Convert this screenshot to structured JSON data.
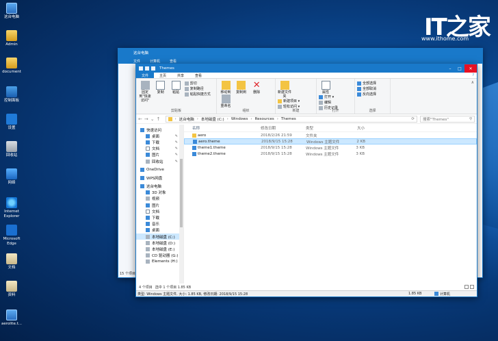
{
  "desktop": {
    "icons": [
      {
        "label": "这台电脑",
        "icon": "computer-icon"
      },
      {
        "label": "Admin",
        "icon": "user-folder-icon"
      },
      {
        "label": "document",
        "icon": "document-folder-icon"
      },
      {
        "label": "控制面板",
        "icon": "control-panel-icon"
      },
      {
        "label": "设置",
        "icon": "settings-icon"
      },
      {
        "label": "回收站",
        "icon": "recycle-bin-icon"
      },
      {
        "label": "网络",
        "icon": "network-icon"
      },
      {
        "label": "Internet Explorer",
        "icon": "ie-icon"
      },
      {
        "label": "Microsoft Edge",
        "icon": "edge-icon"
      },
      {
        "label": "文档",
        "icon": "file-icon"
      },
      {
        "label": "资料",
        "icon": "file-icon"
      },
      {
        "label": "aerolite.t...",
        "icon": "theme-file-icon"
      }
    ],
    "watermark": {
      "logo": "IT之家",
      "url": "www.ithome.com"
    }
  },
  "back_window": {
    "title": "这台电脑",
    "tabs": [
      "文件",
      "计算机",
      "查看"
    ],
    "status": "15 个项目"
  },
  "explorer": {
    "title": "Themes",
    "tabs": {
      "file": "文件",
      "home": "主页",
      "share": "共享",
      "view": "查看"
    },
    "ribbon": {
      "clipboard": {
        "pin": "固定到\"快速访问\"",
        "copy": "复制",
        "paste": "粘贴",
        "cut": "剪切",
        "copy_path": "复制路径",
        "paste_shortcut": "粘贴快捷方式",
        "label": "剪贴板"
      },
      "organize": {
        "move_to": "移动到",
        "copy_to": "复制到",
        "delete": "删除",
        "rename": "重命名",
        "label": "组织"
      },
      "new": {
        "new_folder": "新建文件夹",
        "new_item": "新建项目 ▾",
        "easy_access": "轻松访问 ▾",
        "label": "新建"
      },
      "open": {
        "properties": "属性",
        "open": "打开 ▾",
        "edit": "编辑",
        "history": "历史记录",
        "label": "打开"
      },
      "select": {
        "select_all": "全部选择",
        "select_none": "全部取消",
        "invert": "反向选择",
        "label": "选择"
      }
    },
    "address": {
      "crumbs": [
        "这台电脑",
        "本地磁盘 (C:)",
        "Windows",
        "Resources",
        "Themes"
      ],
      "search_placeholder": "搜索\"Themes\""
    },
    "nav": [
      {
        "label": "快速访问",
        "level": 0,
        "pin": false
      },
      {
        "label": "桌面",
        "level": 1,
        "pin": true
      },
      {
        "label": "下载",
        "level": 1,
        "pin": true
      },
      {
        "label": "文档",
        "level": 1,
        "pin": true
      },
      {
        "label": "图片",
        "level": 1,
        "pin": true
      },
      {
        "label": "回收站",
        "level": 1,
        "pin": true
      },
      {
        "label": "OneDrive",
        "level": 0,
        "pin": false,
        "gap": true
      },
      {
        "label": "WPS网盘",
        "level": 0,
        "pin": false,
        "gap": true
      },
      {
        "label": "这台电脑",
        "level": 0,
        "pin": false,
        "gap": true
      },
      {
        "label": "3D 对象",
        "level": 1,
        "pin": false
      },
      {
        "label": "视频",
        "level": 1,
        "pin": false
      },
      {
        "label": "图片",
        "level": 1,
        "pin": false
      },
      {
        "label": "文档",
        "level": 1,
        "pin": false
      },
      {
        "label": "下载",
        "level": 1,
        "pin": false
      },
      {
        "label": "音乐",
        "level": 1,
        "pin": false
      },
      {
        "label": "桌面",
        "level": 1,
        "pin": false
      },
      {
        "label": "本地磁盘 (C:)",
        "level": 1,
        "pin": false,
        "selected": true
      },
      {
        "label": "本地磁盘 (D:)",
        "level": 1,
        "pin": false
      },
      {
        "label": "本地磁盘 (E:)",
        "level": 1,
        "pin": false
      },
      {
        "label": "CD 驱动器 (G:)",
        "level": 1,
        "pin": false
      },
      {
        "label": "Elements (H:)",
        "level": 1,
        "pin": false
      }
    ],
    "columns": {
      "name": "名称",
      "date": "修改日期",
      "type": "类型",
      "size": "大小"
    },
    "files": [
      {
        "name": "aero",
        "date": "2018/2/26 21:59",
        "type": "文件夹",
        "size": "",
        "kind": "folder"
      },
      {
        "name": "aero.theme",
        "date": "2018/9/15 15:28",
        "type": "Windows 主题文件",
        "size": "2 KB",
        "kind": "theme",
        "selected": true
      },
      {
        "name": "theme1.theme",
        "date": "2018/9/15 15:28",
        "type": "Windows 主题文件",
        "size": "3 KB",
        "kind": "theme"
      },
      {
        "name": "theme2.theme",
        "date": "2018/9/15 15:28",
        "type": "Windows 主题文件",
        "size": "3 KB",
        "kind": "theme"
      }
    ],
    "status": {
      "items": "4 个项目",
      "selected": "选中 1 个项目  1.85 KB"
    },
    "details": {
      "info": "类型: Windows 主题文件, 大小: 1.85 KB, 修改日期: 2018/9/15 15:28",
      "size": "1.85 KB",
      "location": "计算机"
    }
  }
}
